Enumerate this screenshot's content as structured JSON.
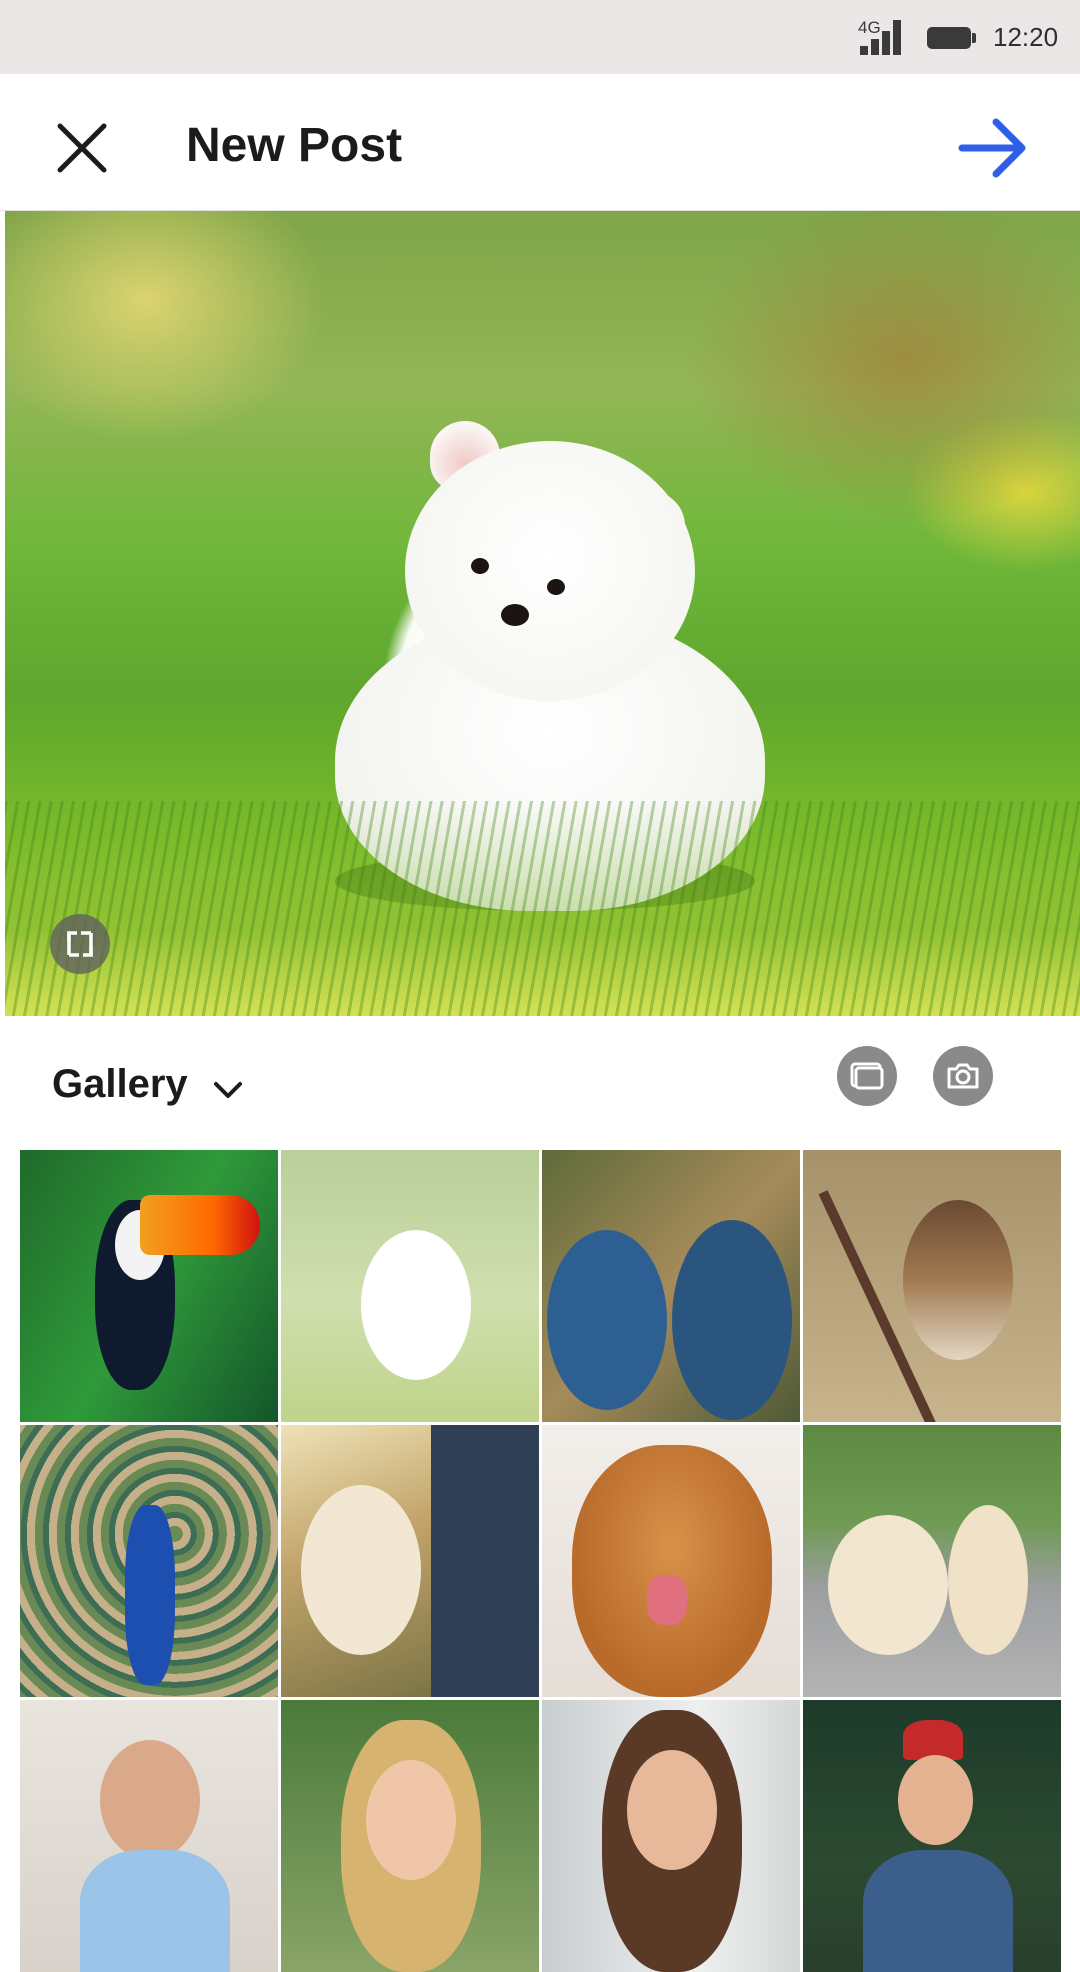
{
  "status_bar": {
    "network": "4G",
    "time": "12:20"
  },
  "header": {
    "title": "New Post",
    "close_icon": "close-icon",
    "next_icon": "arrow-right-icon",
    "accent_color": "#2f5fe8"
  },
  "preview": {
    "expand_icon": "expand-icon"
  },
  "gallery": {
    "label": "Gallery",
    "chevron_icon": "chevron-down-icon",
    "multi_select_icon": "multi-select-icon",
    "camera_icon": "camera-icon"
  },
  "thumbnails": [
    "toucan",
    "white-puppy",
    "blue-parrots",
    "sparrow",
    "peacock",
    "man-with-dog",
    "smiling-dog",
    "two-dogs",
    "woman-waving",
    "blonde-woman",
    "woman-headphones",
    "woman-camera"
  ]
}
